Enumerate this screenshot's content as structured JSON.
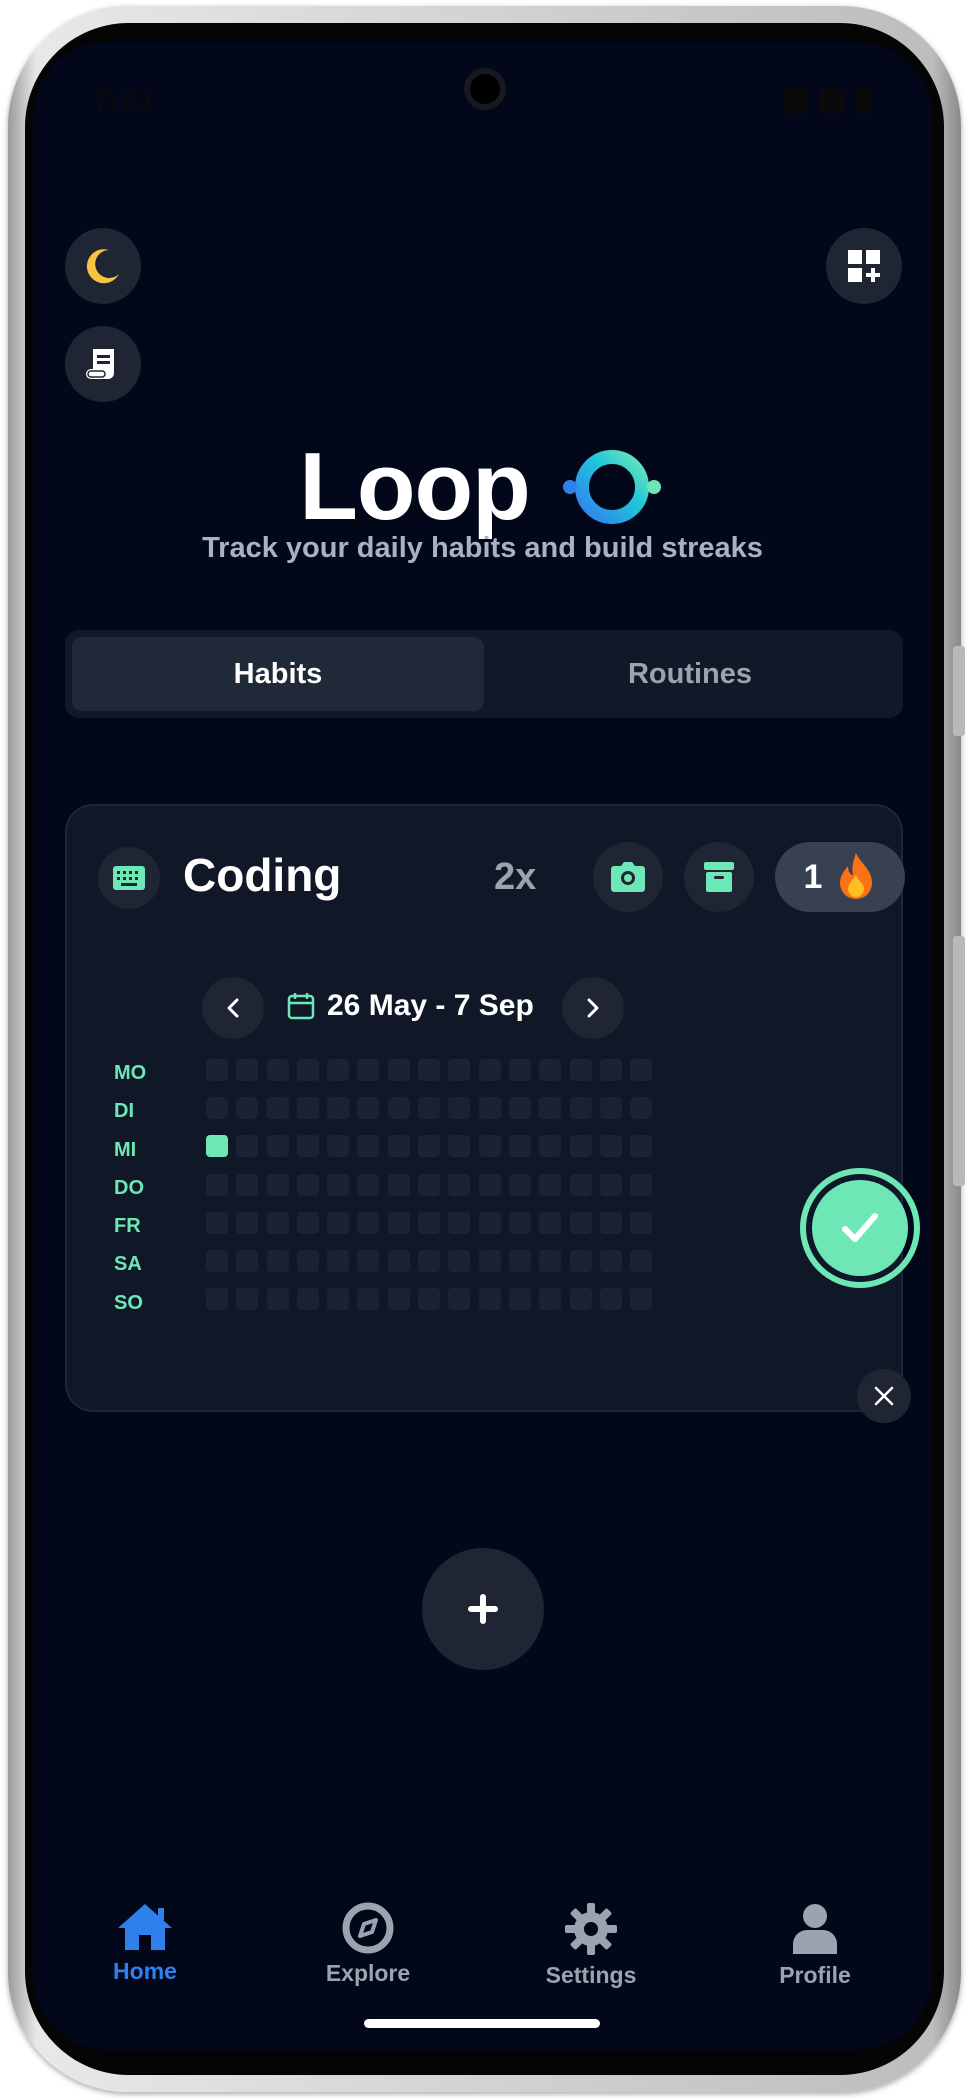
{
  "status_bar": {
    "time": "7:51"
  },
  "header": {
    "title": "Loop",
    "subtitle": "Track your daily habits and build streaks"
  },
  "tabs": [
    {
      "label": "Habits",
      "active": true
    },
    {
      "label": "Routines",
      "active": false
    }
  ],
  "habit_card": {
    "name": "Coding",
    "count_label": "2x",
    "streak": "1",
    "date_range": "26 May - 7 Sep",
    "day_labels": [
      "MO",
      "DI",
      "MI",
      "DO",
      "FR",
      "SA",
      "SO"
    ],
    "weeks": 15,
    "completed_cells": [
      {
        "day": "MI",
        "week": 1
      }
    ]
  },
  "bottom_nav": {
    "home": "Home",
    "explore": "Explore",
    "settings": "Settings",
    "profile": "Profile"
  },
  "colors": {
    "background": "#03071a",
    "accent": "#6ee7b7",
    "active_nav": "#2f80ed",
    "moon": "#f5c542"
  },
  "icons": [
    "moon-icon",
    "scroll-icon",
    "widget-add-icon",
    "loop-logo-icon",
    "keyboard-icon",
    "camera-icon",
    "archive-icon",
    "fire-icon",
    "chevron-left-icon",
    "calendar-icon",
    "chevron-right-icon",
    "check-icon",
    "close-icon",
    "plus-icon",
    "home-icon",
    "compass-icon",
    "gear-icon",
    "person-icon"
  ]
}
